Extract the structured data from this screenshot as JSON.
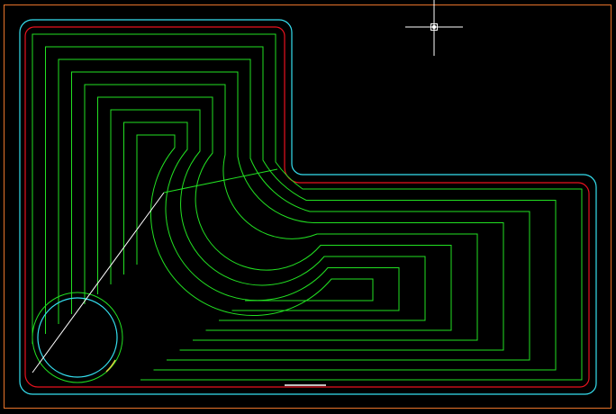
{
  "colors": {
    "background": "#000000",
    "sheet_border": "#E8732A",
    "outer_contour": "#35E0F0",
    "boundary": "#E8121E",
    "toolpath": "#22E022",
    "hole": "#35E0F0",
    "guide_line": "#FFFFFF",
    "crosshair": "#FFFFFF",
    "highlight": "#E0D040"
  },
  "icons": {
    "cursor": "crosshair-cursor-icon"
  }
}
